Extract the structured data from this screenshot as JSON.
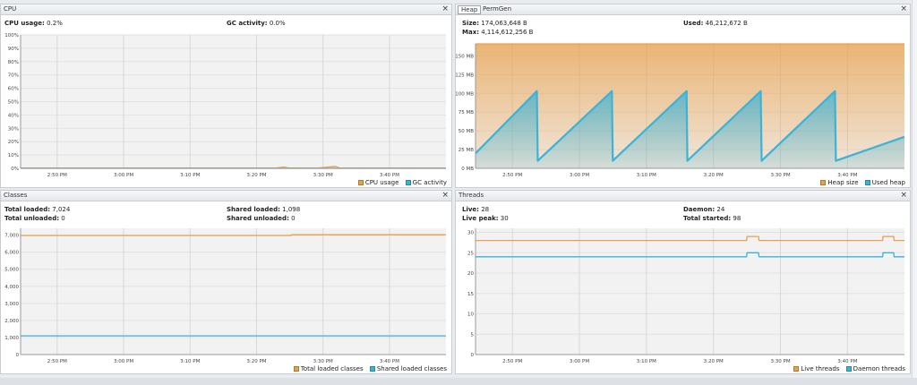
{
  "colors": {
    "orange": "#e8a04c",
    "blue": "#3bb3d8",
    "grid": "#d8d8d8",
    "plot_bg": "#f2f2f2"
  },
  "cpu": {
    "title": "CPU",
    "cpu_usage_label": "CPU usage:",
    "cpu_usage_value": "0.2%",
    "gc_activity_label": "GC activity:",
    "gc_activity_value": "0.0%",
    "legend": [
      "CPU usage",
      "GC activity"
    ]
  },
  "heap": {
    "tabs": [
      "Heap",
      "PermGen"
    ],
    "size_label": "Size:",
    "size_value": "174,063,648 B",
    "used_label": "Used:",
    "used_value": "46,212,672 B",
    "max_label": "Max:",
    "max_value": "4,114,612,256 B",
    "legend": [
      "Heap size",
      "Used heap"
    ]
  },
  "classes": {
    "title": "Classes",
    "total_loaded_label": "Total loaded:",
    "total_loaded_value": "7,024",
    "total_unloaded_label": "Total unloaded:",
    "total_unloaded_value": "0",
    "shared_loaded_label": "Shared loaded:",
    "shared_loaded_value": "1,098",
    "shared_unloaded_label": "Shared unloaded:",
    "shared_unloaded_value": "0",
    "legend": [
      "Total loaded classes",
      "Shared loaded classes"
    ]
  },
  "threads": {
    "title": "Threads",
    "live_label": "Live:",
    "live_value": "28",
    "live_peak_label": "Live peak:",
    "live_peak_value": "30",
    "daemon_label": "Daemon:",
    "daemon_value": "24",
    "total_started_label": "Total started:",
    "total_started_value": "98",
    "legend": [
      "Live threads",
      "Daemon threads"
    ]
  },
  "chart_data": [
    {
      "type": "area",
      "panel": "CPU",
      "x_ticks": [
        "2:50 PM",
        "3:00 PM",
        "3:10 PM",
        "3:20 PM",
        "3:30 PM",
        "3:40 PM"
      ],
      "y_ticks": [
        "0%",
        "10%",
        "20%",
        "30%",
        "40%",
        "50%",
        "60%",
        "70%",
        "80%",
        "90%",
        "100%"
      ],
      "ylim": [
        0,
        100
      ],
      "grid": true,
      "legend_position": "bottom-right",
      "series": [
        {
          "name": "CPU usage",
          "color": "#e8a04c",
          "x": [
            0,
            0.1,
            0.2,
            0.3,
            0.4,
            0.5,
            0.6,
            0.62,
            0.63,
            0.7,
            0.74,
            0.75,
            0.8,
            0.9,
            1.0
          ],
          "values": [
            0.3,
            0.2,
            0.3,
            0.2,
            0.3,
            0.2,
            0.3,
            1.0,
            0.3,
            0.2,
            1.5,
            0.3,
            0.2,
            0.3,
            0.2
          ]
        },
        {
          "name": "GC activity",
          "color": "#3bb3d8",
          "x": [
            0,
            1.0
          ],
          "values": [
            0,
            0
          ]
        }
      ]
    },
    {
      "type": "area",
      "panel": "Heap",
      "x_ticks": [
        "2:50 PM",
        "3:00 PM",
        "3:10 PM",
        "3:20 PM",
        "3:30 PM",
        "3:40 PM"
      ],
      "y_ticks": [
        "0 MB",
        "25 MB",
        "50 MB",
        "75 MB",
        "100 MB",
        "125 MB",
        "150 MB"
      ],
      "ylim": [
        0,
        166
      ],
      "grid": true,
      "legend_position": "bottom-right",
      "series": [
        {
          "name": "Heap size",
          "color": "#e8a04c",
          "x": [
            0,
            1
          ],
          "values": [
            166,
            166
          ]
        },
        {
          "name": "Used heap",
          "color": "#3bb3d8",
          "x": [
            0,
            0.143,
            0.145,
            0.318,
            0.32,
            0.492,
            0.494,
            0.665,
            0.667,
            0.838,
            0.84,
            1.0
          ],
          "values": [
            20,
            103,
            10,
            103,
            10,
            103,
            10,
            103,
            10,
            103,
            10,
            42
          ]
        }
      ]
    },
    {
      "type": "line",
      "panel": "Classes",
      "x_ticks": [
        "2:50 PM",
        "3:00 PM",
        "3:10 PM",
        "3:20 PM",
        "3:30 PM",
        "3:40 PM"
      ],
      "y_ticks": [
        "0",
        "1,000",
        "2,000",
        "3,000",
        "4,000",
        "5,000",
        "6,000",
        "7,000"
      ],
      "ylim": [
        0,
        7400
      ],
      "grid": true,
      "legend_position": "bottom-right",
      "series": [
        {
          "name": "Total loaded classes",
          "color": "#e8a04c",
          "x": [
            0,
            0.636,
            0.637,
            1.0
          ],
          "values": [
            6980,
            6980,
            7024,
            7024
          ]
        },
        {
          "name": "Shared loaded classes",
          "color": "#3bb3d8",
          "x": [
            0,
            1.0
          ],
          "values": [
            1098,
            1098
          ]
        }
      ]
    },
    {
      "type": "line",
      "panel": "Threads",
      "x_ticks": [
        "2:50 PM",
        "3:00 PM",
        "3:10 PM",
        "3:20 PM",
        "3:30 PM",
        "3:40 PM"
      ],
      "y_ticks": [
        "0",
        "5",
        "10",
        "15",
        "20",
        "25",
        "30"
      ],
      "ylim": [
        0,
        31
      ],
      "grid": true,
      "legend_position": "bottom-right",
      "series": [
        {
          "name": "Live threads",
          "color": "#e8a04c",
          "x": [
            0,
            0.632,
            0.633,
            0.66,
            0.661,
            0.949,
            0.95,
            0.975,
            0.976,
            1.0
          ],
          "values": [
            28,
            28,
            29,
            29,
            28,
            28,
            29,
            29,
            28,
            28
          ]
        },
        {
          "name": "Daemon threads",
          "color": "#3bb3d8",
          "x": [
            0,
            0.632,
            0.633,
            0.66,
            0.661,
            0.949,
            0.95,
            0.975,
            0.976,
            1.0
          ],
          "values": [
            24,
            24,
            25,
            25,
            24,
            24,
            25,
            25,
            24,
            24
          ]
        }
      ]
    }
  ]
}
